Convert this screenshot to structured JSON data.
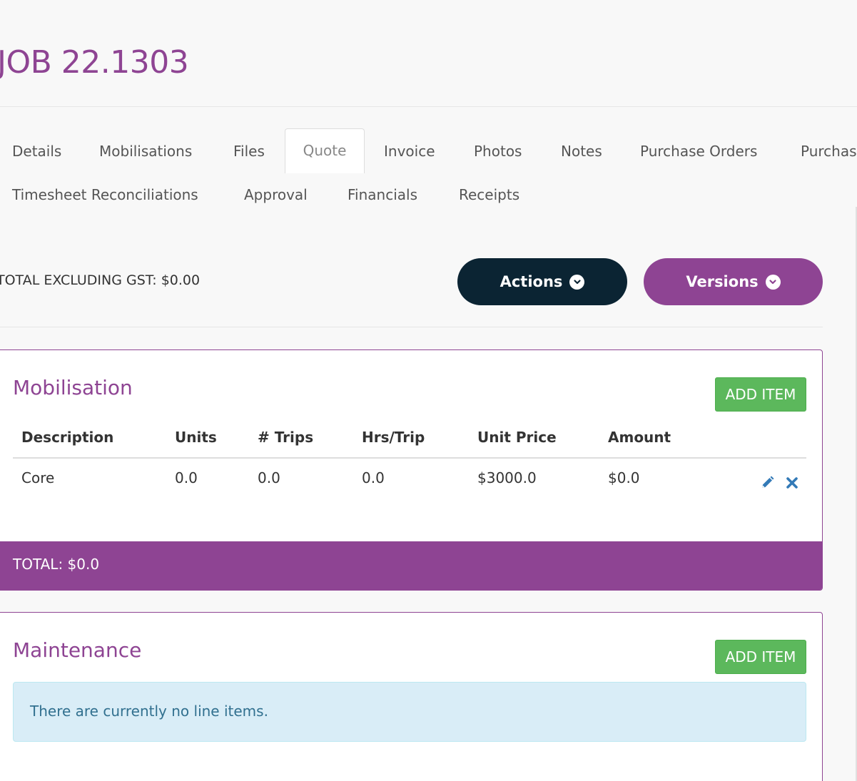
{
  "job": {
    "title": "JOB 22.1303"
  },
  "tabs": [
    {
      "label": "Details"
    },
    {
      "label": "Mobilisations"
    },
    {
      "label": "Files"
    },
    {
      "label": "Quote"
    },
    {
      "label": "Invoice"
    },
    {
      "label": "Photos"
    },
    {
      "label": "Notes"
    },
    {
      "label": "Purchase Orders"
    },
    {
      "label": "Purchas"
    },
    {
      "label": "Timesheet Reconciliations"
    },
    {
      "label": "Approval"
    },
    {
      "label": "Financials"
    },
    {
      "label": "Receipts"
    }
  ],
  "active_tab": "Quote",
  "summary": {
    "total_excl_gst": "TOTAL EXCLUDING GST: $0.00",
    "actions_label": "Actions",
    "versions_label": "Versions"
  },
  "mobilisation": {
    "title": "Mobilisation",
    "add_label": "ADD ITEM",
    "columns": [
      "Description",
      "Units",
      "# Trips",
      "Hrs/Trip",
      "Unit Price",
      "Amount"
    ],
    "rows": [
      {
        "description": "Core",
        "units": "0.0",
        "trips": "0.0",
        "hrs_trip": "0.0",
        "unit_price": "$3000.0",
        "amount": "$0.0"
      }
    ],
    "total": "TOTAL: $0.0"
  },
  "maintenance": {
    "title": "Maintenance",
    "add_label": "ADD ITEM",
    "empty_message": "There are currently no line items."
  },
  "colors": {
    "brand": "#8e4493",
    "dark": "#0b2433",
    "success": "#5cb85c",
    "info_bg": "#d9edf7",
    "icon_blue": "#337ab7"
  }
}
